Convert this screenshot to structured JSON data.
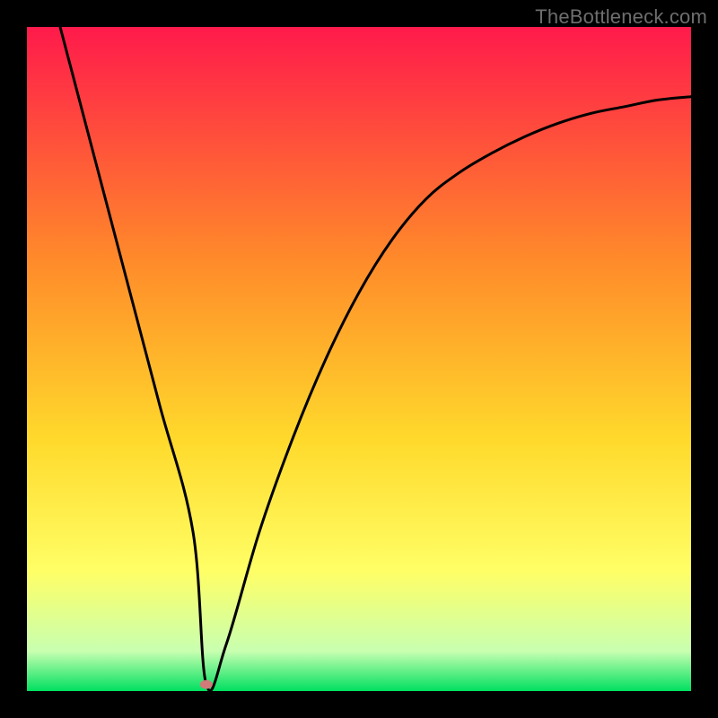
{
  "watermark": "TheBottleneck.com",
  "colors": {
    "gradient_top": "#ff1a4b",
    "gradient_mid1": "#ff8a2a",
    "gradient_mid2": "#ffd92b",
    "gradient_mid3": "#ffff66",
    "gradient_bottom_band": "#c8ffb0",
    "gradient_bottom": "#00e060",
    "curve": "#000000",
    "marker": "#d07a7a",
    "frame_bg": "#000000"
  },
  "chart_data": {
    "type": "line",
    "title": "",
    "xlabel": "",
    "ylabel": "",
    "xlim": [
      0,
      100
    ],
    "ylim": [
      0,
      100
    ],
    "series": [
      {
        "name": "bottleneck-curve",
        "x": [
          5,
          10,
          15,
          20,
          25,
          27,
          30,
          35,
          40,
          45,
          50,
          55,
          60,
          65,
          70,
          75,
          80,
          85,
          90,
          95,
          100
        ],
        "y": [
          100,
          81,
          62,
          43,
          24,
          1,
          7,
          24,
          38,
          50,
          60,
          68,
          74,
          78,
          81,
          83.5,
          85.5,
          87,
          88,
          89,
          89.5
        ]
      }
    ],
    "annotations": [
      {
        "type": "marker",
        "x": 27,
        "y": 1,
        "name": "bottleneck-minimum"
      }
    ],
    "minimum": {
      "x": 27,
      "y": 1
    }
  }
}
